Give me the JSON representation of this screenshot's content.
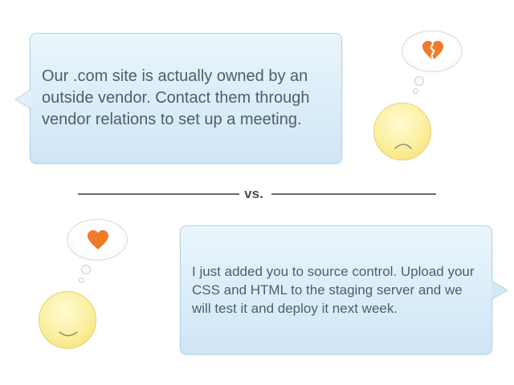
{
  "top_message": {
    "text": "Our .com site is actually owned by an outside vendor. Contact them through vendor relations to set up a meeting."
  },
  "separator": {
    "label": "vs."
  },
  "bottom_message": {
    "text": "I just added you to source control. Upload your CSS and HTML to the staging server and we will test it and deploy it next week."
  },
  "icons": {
    "top_thought": "broken-heart-icon",
    "top_face": "sad-face-icon",
    "bottom_thought": "heart-icon",
    "bottom_face": "happy-face-icon"
  },
  "colors": {
    "bubble_fill": "#d8ecf8",
    "bubble_border": "#b3d3e6",
    "heart": "#ef7a2a",
    "face": "#f8e98a"
  }
}
